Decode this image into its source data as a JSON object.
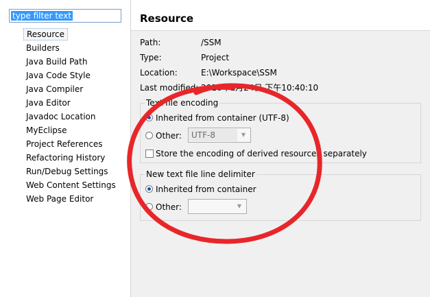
{
  "filter": {
    "text": "type filter text"
  },
  "tree": {
    "items": [
      {
        "label": "Resource",
        "selected": true
      },
      {
        "label": "Builders"
      },
      {
        "label": "Java Build Path"
      },
      {
        "label": "Java Code Style"
      },
      {
        "label": "Java Compiler"
      },
      {
        "label": "Java Editor"
      },
      {
        "label": "Javadoc Location"
      },
      {
        "label": "MyEclipse"
      },
      {
        "label": "Project References"
      },
      {
        "label": "Refactoring History"
      },
      {
        "label": "Run/Debug Settings"
      },
      {
        "label": "Web Content Settings"
      },
      {
        "label": "Web Page Editor"
      }
    ]
  },
  "page": {
    "title": "Resource",
    "info": [
      {
        "key": "Path:",
        "value": "/SSM"
      },
      {
        "key": "Type:",
        "value": "Project"
      },
      {
        "key": "Location:",
        "value": "E:\\Workspace\\SSM"
      },
      {
        "key": "Last modified:",
        "value": "2016年1月24日 下午10:40:10"
      }
    ]
  },
  "encoding": {
    "legend": "Text file encoding",
    "inherited_label": "Inherited from container (UTF-8)",
    "other_label": "Other:",
    "other_value": "UTF-8",
    "store_label": "Store the encoding of derived resources separately",
    "selected": "inherited"
  },
  "delimiter": {
    "legend": "New text file line delimiter",
    "inherited_label": "Inherited from container",
    "other_label": "Other:",
    "other_value": "",
    "selected": "inherited"
  },
  "annotation": {
    "color": "#e8262a"
  }
}
